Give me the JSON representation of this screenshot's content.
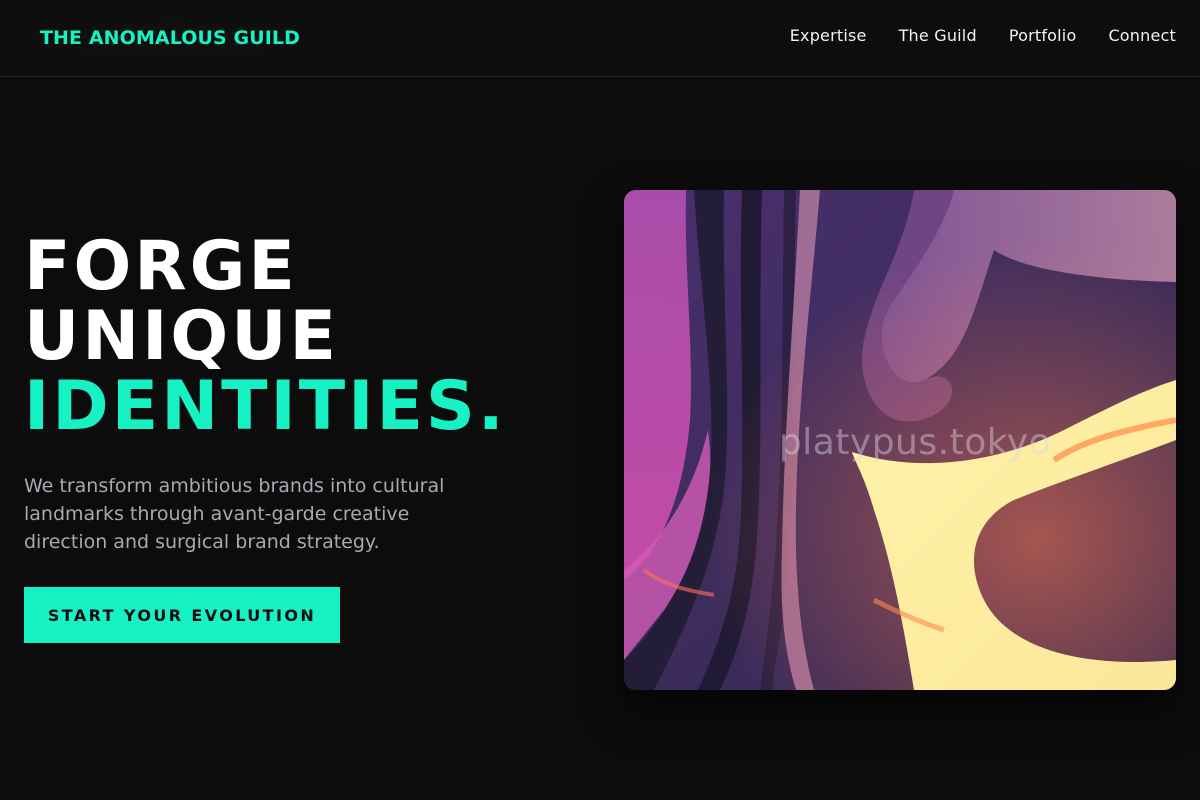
{
  "brand": {
    "name": "THE ANOMALOUS GUILD",
    "accent_color": "#16f2c3",
    "background_color": "#0c0c0c"
  },
  "nav": {
    "items": [
      {
        "label": "Expertise"
      },
      {
        "label": "The Guild"
      },
      {
        "label": "Portfolio"
      },
      {
        "label": "Connect"
      }
    ]
  },
  "hero": {
    "headline": {
      "line1": "FORGE",
      "line2": "UNIQUE",
      "line3": "IDENTITIES."
    },
    "subtext": "We transform ambitious brands into cultural landmarks through avant-garde creative direction and surgical brand strategy.",
    "cta_label": "START YOUR EVOLUTION",
    "image": {
      "watermark": "platypus.tokyo",
      "alt": "Abstract purple and pale-yellow flowing artwork"
    }
  }
}
